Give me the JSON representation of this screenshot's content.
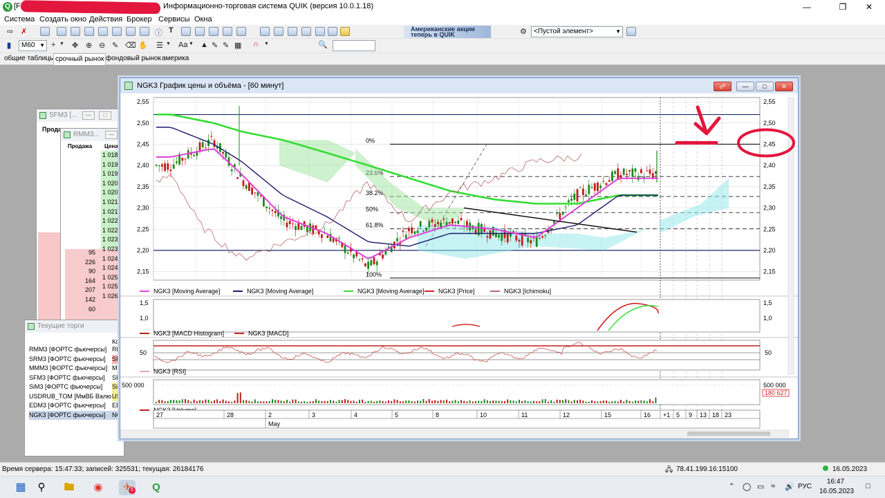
{
  "window": {
    "title": "Информационно-торговая система QUIK (версия 10.0.1.18)",
    "title_prefix": "[F",
    "app_icon": "Q"
  },
  "menu": [
    "Система",
    "Создать окно",
    "Действия",
    "Брокер",
    "Сервисы",
    "Окна"
  ],
  "toolbar": {
    "banner_line1": "Американские акции",
    "banner_line2": "теперь в QUIK",
    "empty_element": "<Пустой элемент>",
    "interval": "M60",
    "font_label": "Aa",
    "search_value": ""
  },
  "tabs": [
    "общие таблицы",
    "срочный рынок",
    "фондовый рынок",
    "америка"
  ],
  "sfm_window": {
    "title": "SFM3 [...",
    "header": "Прода"
  },
  "rmm_window": {
    "title": "RMM3...",
    "col_sell": "Продажа",
    "col_price": "Цена",
    "prices": [
      "1 018,",
      "1 019,",
      "1 019,",
      "1 020,",
      "1 020,",
      "1 021,",
      "1 021,",
      "1 022,",
      "1 022,",
      "1 023,",
      "1 023,",
      "1 024,",
      "1 024,",
      "1 025,",
      "1 025,",
      "1 026,"
    ],
    "volumes": [
      "95",
      "226",
      "90",
      "164",
      "207",
      "142",
      "60"
    ]
  },
  "current_trading": {
    "title": "Текущие торги",
    "code_header": "Код",
    "rows": [
      {
        "name": "RMM3 [ФОРТС фьючерсы]",
        "code": "RM"
      },
      {
        "name": "SRM3 [ФОРТС фьючерсы]",
        "code": "SF"
      },
      {
        "name": "MMM3 [ФОРТС фьючерсы]",
        "code": "MI"
      },
      {
        "name": "SFM3 [ФОРТС фьючерсы]",
        "code": "SF"
      },
      {
        "name": "SiM3 [ФОРТС фьючерсы]",
        "code": "Si"
      },
      {
        "name": "USDRUB_TOM [МмВБ Валю",
        "code": "US"
      },
      {
        "name": "EDM3 [ФОРТС фьючерсы]",
        "code": "ED"
      },
      {
        "name": "NGK3 [ФОРТС фьючерсы]",
        "code": "NG"
      }
    ]
  },
  "chart": {
    "caption": "NGK3 График цены и объёма - [60 минут]",
    "price_axis": [
      "2,55",
      "2,50",
      "2,45",
      "2,40",
      "2,35",
      "2,30",
      "2,25",
      "2,20",
      "2,15"
    ],
    "fib_labels": [
      "0%",
      "23.6%",
      "38.2%",
      "50%",
      "61.8%",
      "100%"
    ],
    "legend_price": [
      "NGK3 [Moving Average]",
      "NGK3 [Moving Average]",
      "NGK3 [Moving Average]",
      "NGK3 [Price]",
      "NGK3 [Ichimoku]"
    ],
    "macd_axis": [
      "1,5",
      "1,0"
    ],
    "legend_macd": [
      "NGK3 [MACD Histogram]",
      "NGK3 [MACD]"
    ],
    "rsi_axis": "50",
    "legend_rsi": "NGK3 [RSI]",
    "volume_axis": "500 000",
    "volume_current": "180 627",
    "legend_volume": "NGK3 [Volume]",
    "date_ticks": [
      "27",
      "28",
      "2",
      "3",
      "4",
      "5",
      "8",
      "10",
      "11",
      "12",
      "15",
      "16",
      "+1",
      "5",
      "9",
      "13",
      "18",
      "23"
    ],
    "month_label": "May",
    "colors": {
      "ma_fast": "#e040d8",
      "ma_mid": "#1a1a6e",
      "ma_slow": "#33dd33",
      "price": "#d42020",
      "ichimoku": "#b86a6a",
      "annotation": "#e3173d"
    },
    "chart_data": {
      "type": "line",
      "title": "NGK3 График цены и объёма - [60 минут]",
      "xlabel": "",
      "ylabel": "",
      "ylim": [
        2.13,
        2.56
      ],
      "x": [
        "27",
        "28",
        "2",
        "3",
        "4",
        "5",
        "8",
        "10",
        "11",
        "12",
        "15",
        "16"
      ],
      "series": [
        {
          "name": "NGK3 [Price]",
          "values": [
            2.4,
            2.46,
            2.37,
            2.27,
            2.24,
            2.16,
            2.25,
            2.27,
            2.24,
            2.22,
            2.33,
            2.38
          ]
        },
        {
          "name": "NGK3 [Moving Average]",
          "values": [
            2.42,
            2.44,
            2.38,
            2.28,
            2.24,
            2.18,
            2.23,
            2.26,
            2.25,
            2.23,
            2.3,
            2.37
          ]
        },
        {
          "name": "NGK3 [Moving Average]",
          "values": [
            2.49,
            2.45,
            2.41,
            2.33,
            2.28,
            2.22,
            2.21,
            2.24,
            2.24,
            2.24,
            2.26,
            2.33
          ]
        },
        {
          "name": "NGK3 [Moving Average]",
          "values": [
            2.52,
            2.5,
            2.48,
            2.46,
            2.43,
            2.4,
            2.37,
            2.34,
            2.32,
            2.31,
            2.31,
            2.33
          ]
        }
      ],
      "grid": true
    }
  },
  "status": {
    "server_time": "Время сервера: 15:47:33; записей: 325531; текущая: 26184176",
    "ip": "78.41.199.16:15100",
    "date": "16.05.2023"
  },
  "taskbar": {
    "lang": "РУС",
    "time": "16:47",
    "date": "16.05.2023",
    "badge": "5"
  }
}
